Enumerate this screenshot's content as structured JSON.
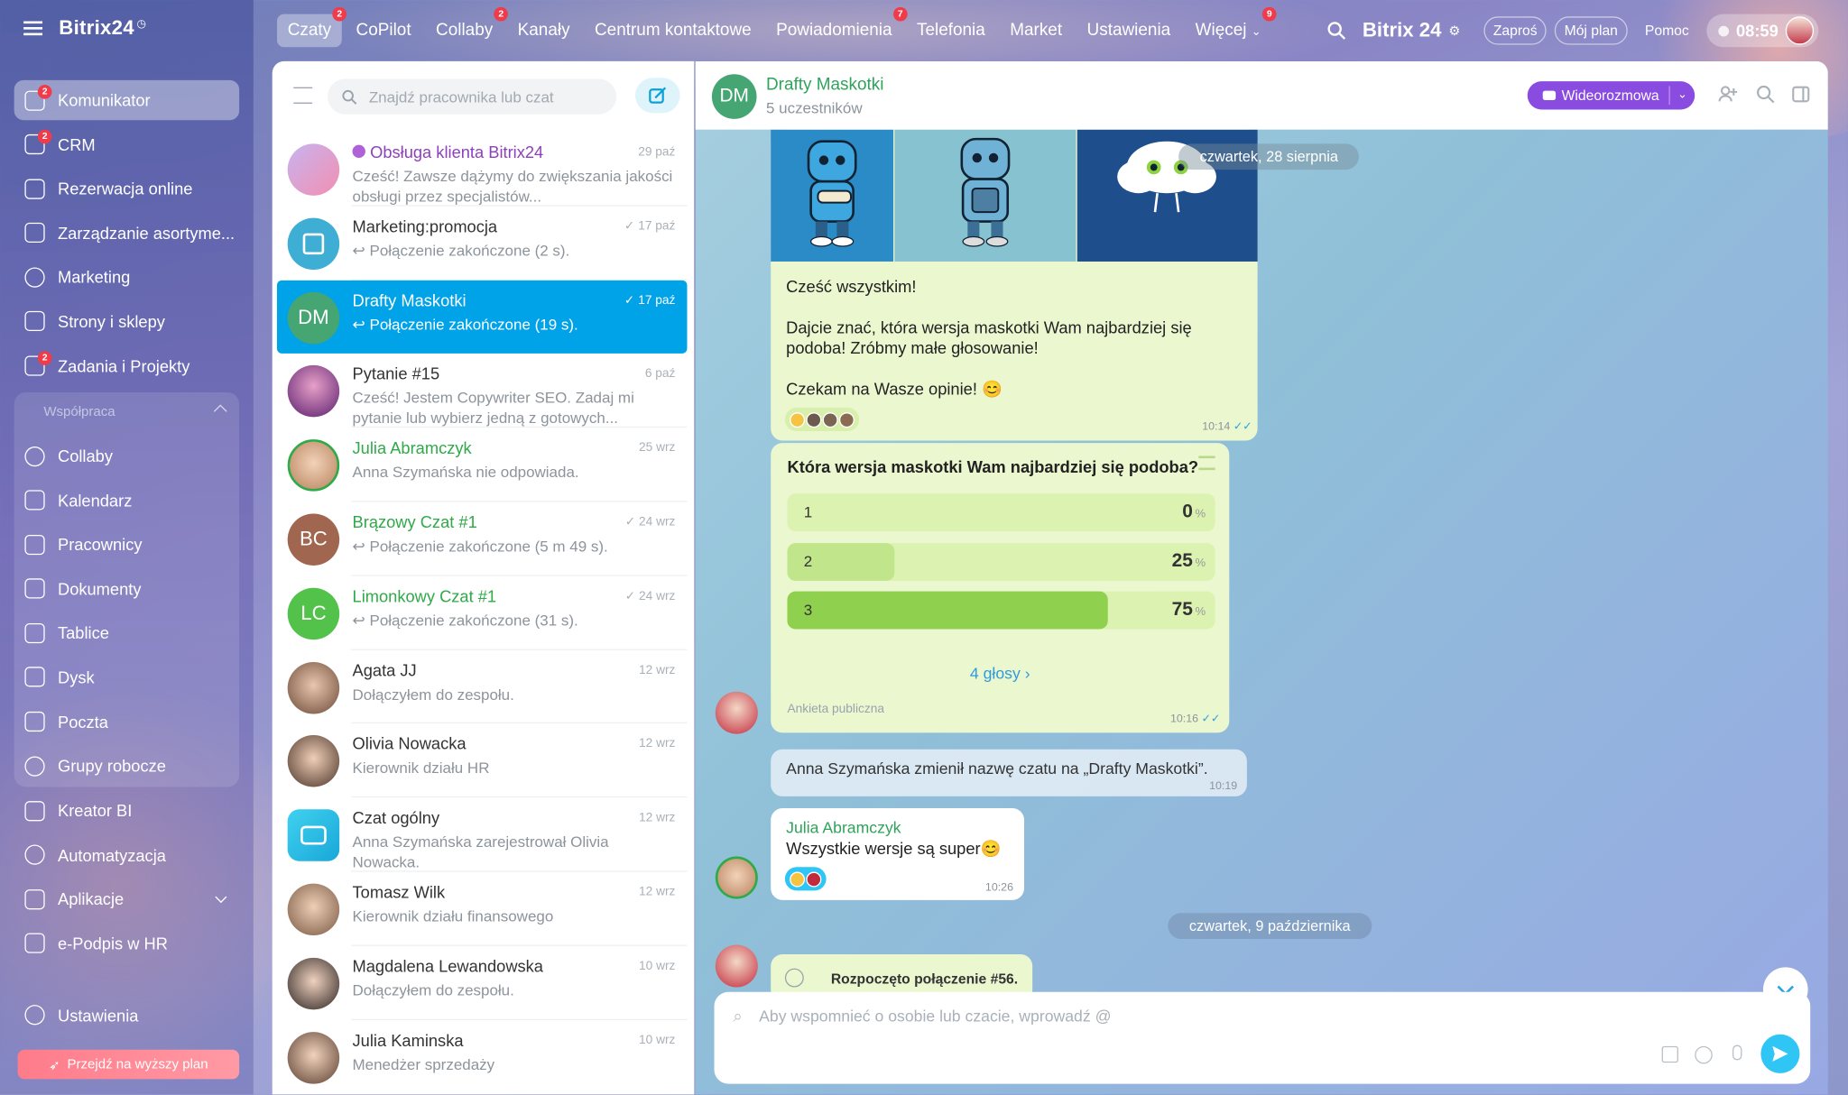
{
  "app": {
    "name": "Bitrix24"
  },
  "sidebar": {
    "items": [
      {
        "label": "Komunikator",
        "badge": "2"
      },
      {
        "label": "CRM",
        "badge": "2"
      },
      {
        "label": "Rezerwacja online",
        "badge": ""
      },
      {
        "label": "Zarządzanie asortyme...",
        "badge": ""
      },
      {
        "label": "Marketing",
        "badge": ""
      },
      {
        "label": "Strony i sklepy",
        "badge": ""
      },
      {
        "label": "Zadania i Projekty",
        "badge": "2"
      }
    ],
    "group_label": "Współpraca",
    "group_items": [
      "Collaby",
      "Kalendarz",
      "Pracownicy",
      "Dokumenty",
      "Tablice",
      "Dysk",
      "Poczta",
      "Grupy robocze"
    ],
    "items2": [
      "Kreator BI",
      "Automatyzacja",
      "Aplikacje",
      "e-Podpis w HR"
    ],
    "settings": "Ustawienia",
    "upgrade": "Przejdź na wyższy plan"
  },
  "topbar": {
    "tabs": [
      {
        "label": "Czaty",
        "badge": "2"
      },
      {
        "label": "CoPilot",
        "badge": ""
      },
      {
        "label": "Collaby",
        "badge": "2"
      },
      {
        "label": "Kanały",
        "badge": ""
      },
      {
        "label": "Centrum kontaktowe",
        "badge": ""
      },
      {
        "label": "Powiadomienia",
        "badge": "7"
      },
      {
        "label": "Telefonia",
        "badge": ""
      },
      {
        "label": "Market",
        "badge": ""
      },
      {
        "label": "Ustawienia",
        "badge": ""
      },
      {
        "label": "Więcej",
        "badge": "9"
      }
    ],
    "brand": "Bitrix 24",
    "invite": "Zaproś",
    "plan": "Mój plan",
    "help": "Pomoc",
    "clock": "08:59"
  },
  "chatlist": {
    "search_placeholder": "Znajdź pracownika lub czat",
    "chats": [
      {
        "title": "Obsługa klienta Bitrix24",
        "sub": "Cześć! Zawsze dążymy do zwiększania jakości obsługi przez specjalistów...",
        "date": "29 paź"
      },
      {
        "title": "Marketing:promocja",
        "sub": "Połączenie zakończone (2 s).",
        "date": "17 paź"
      },
      {
        "title": "Drafty Maskotki",
        "sub": "Połączenie zakończone (19 s).",
        "date": "17 paź",
        "initials": "DM"
      },
      {
        "title": "Pytanie #15",
        "sub": "Cześć! Jestem Copywriter SEO. Zadaj mi pytanie lub wybierz jedną z gotowych...",
        "date": "6 paź"
      },
      {
        "title": "Julia Abramczyk",
        "sub": "Anna Szymańska nie odpowiada.",
        "date": "25 wrz"
      },
      {
        "title": "Brązowy Czat #1",
        "sub": "Połączenie zakończone (5 m 49 s).",
        "date": "24 wrz",
        "initials": "BC"
      },
      {
        "title": "Limonkowy Czat #1",
        "sub": "Połączenie zakończone (31 s).",
        "date": "24 wrz",
        "initials": "LC"
      },
      {
        "title": "Agata JJ",
        "sub": "Dołączyłem do zespołu.",
        "date": "12 wrz"
      },
      {
        "title": "Olivia Nowacka",
        "sub": "Kierownik działu HR",
        "date": "12 wrz"
      },
      {
        "title": "Czat ogólny",
        "sub": "Anna Szymańska zarejestrował Olivia Nowacka.",
        "date": "12 wrz"
      },
      {
        "title": "Tomasz Wilk",
        "sub": "Kierownik działu finansowego",
        "date": "12 wrz"
      },
      {
        "title": "Magdalena Lewandowska",
        "sub": "Dołączyłem do zespołu.",
        "date": "10 wrz"
      },
      {
        "title": "Julia Kaminska",
        "sub": "Menedżer sprzedaży",
        "date": "10 wrz"
      }
    ]
  },
  "chat": {
    "avatar": "DM",
    "title": "Drafty Maskotki",
    "members": "5 uczestników",
    "video": "Wideorozmowa",
    "date1": "czwartek, 28 sierpnia",
    "msg1": {
      "l1": "Cześć wszystkim!",
      "l2": "Dajcie znać, która wersja maskotki Wam najbardziej się podoba! Zróbmy małe głosowanie!",
      "l3": "Czekam na Wasze opinie! 😊",
      "time": "10:14"
    },
    "poll": {
      "question": "Która wersja maskotki Wam najbardziej się podoba?",
      "options": [
        {
          "label": "1",
          "pct": "0"
        },
        {
          "label": "2",
          "pct": "25"
        },
        {
          "label": "3",
          "pct": "75"
        }
      ],
      "pct_sign": "%",
      "votes": "4 głosy",
      "type": "Ankieta publiczna",
      "time": "10:16"
    },
    "system": {
      "text": "Anna Szymańska zmienił nazwę czatu na „Drafty Maskotki”.",
      "time": "10:19"
    },
    "msg2": {
      "author": "Julia Abramczyk",
      "text": "Wszystkie wersje są super😊",
      "time": "10:26"
    },
    "date2": "czwartek, 9 października",
    "call": "Rozpoczęto połączenie #56.",
    "composer_placeholder": "Aby wspomnieć o osobie lub czacie, wprowadź @"
  },
  "colors": {
    "accent": "#00a2e8",
    "green": "#2faa48",
    "poll_fill": "#8fd14f",
    "video": "#8a4be0"
  }
}
